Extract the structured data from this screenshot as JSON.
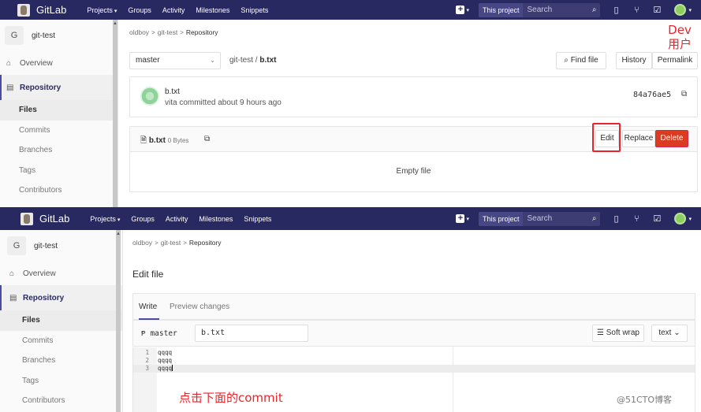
{
  "nav": {
    "brand": "GitLab",
    "links": [
      "Projects",
      "Groups",
      "Activity",
      "Milestones",
      "Snippets"
    ],
    "scope": "This project",
    "search_placeholder": "Search"
  },
  "sidebar": {
    "project_initial": "G",
    "project_name": "git-test",
    "overview": "Overview",
    "repository": "Repository",
    "subitems": [
      "Files",
      "Commits",
      "Branches",
      "Tags",
      "Contributors"
    ]
  },
  "breadcrumb": {
    "owner": "oldboy",
    "project": "git-test",
    "current": "Repository"
  },
  "repo_view": {
    "branch": "master",
    "path_project": "git-test",
    "path_sep": "/",
    "file": "b.txt",
    "find_file": "Find file",
    "history": "History",
    "permalink": "Permalink",
    "commit_title": "b.txt",
    "commit_meta": "vita committed about 9 hours ago",
    "commit_sha": "84a76ae5",
    "file_name": "b.txt",
    "file_size": "0 Bytes",
    "edit": "Edit",
    "replace": "Replace",
    "delete": "Delete",
    "empty_text": "Empty file"
  },
  "annotations": {
    "dev_line1": "Dev",
    "dev_line2": "用户",
    "commit_hint": "点击下面的commit",
    "watermark": "@51CTO博客"
  },
  "edit_view": {
    "title": "Edit file",
    "tab_write": "Write",
    "tab_preview": "Preview changes",
    "branch_glyph": "Ᵽ",
    "branch": "master",
    "file_name": "b.txt",
    "soft_wrap": "Soft wrap",
    "mode": "text",
    "lines": [
      {
        "n": "1",
        "text": "qqqq"
      },
      {
        "n": "2",
        "text": "qqqq"
      },
      {
        "n": "3",
        "text": "qqqq"
      }
    ]
  },
  "colors": {
    "navbar": "#292961",
    "delete_button": "#db3b21",
    "annotation_red": "#e8252b",
    "active_accent": "#4b4ba3"
  }
}
